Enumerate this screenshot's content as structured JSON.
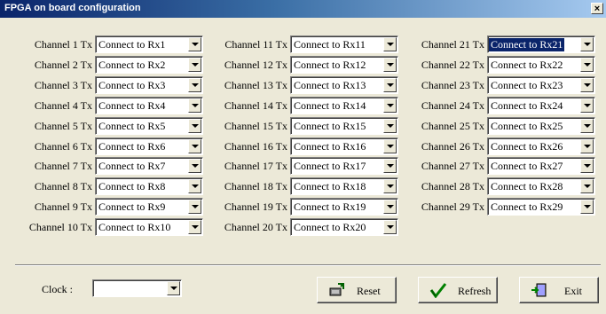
{
  "window": {
    "title": "FPGA on board configuration",
    "close": "×"
  },
  "channels": [
    {
      "label": "Channel 1 Tx",
      "value": "Connect to Rx1"
    },
    {
      "label": "Channel 2 Tx",
      "value": "Connect to Rx2"
    },
    {
      "label": "Channel 3 Tx",
      "value": "Connect to Rx3"
    },
    {
      "label": "Channel 4 Tx",
      "value": "Connect to Rx4"
    },
    {
      "label": "Channel 5 Tx",
      "value": "Connect to Rx5"
    },
    {
      "label": "Channel 6 Tx",
      "value": "Connect to Rx6"
    },
    {
      "label": "Channel 7 Tx",
      "value": "Connect to Rx7"
    },
    {
      "label": "Channel 8 Tx",
      "value": "Connect to Rx8"
    },
    {
      "label": "Channel 9 Tx",
      "value": "Connect to Rx9"
    },
    {
      "label": "Channel 10 Tx",
      "value": "Connect to Rx10"
    },
    {
      "label": "Channel 11 Tx",
      "value": "Connect to Rx11"
    },
    {
      "label": "Channel 12 Tx",
      "value": "Connect to Rx12"
    },
    {
      "label": "Channel 13 Tx",
      "value": "Connect to Rx13"
    },
    {
      "label": "Channel 14 Tx",
      "value": "Connect to Rx14"
    },
    {
      "label": "Channel 15 Tx",
      "value": "Connect to Rx15"
    },
    {
      "label": "Channel 16 Tx",
      "value": "Connect to Rx16"
    },
    {
      "label": "Channel 17 Tx",
      "value": "Connect to Rx17"
    },
    {
      "label": "Channel 18 Tx",
      "value": "Connect to Rx18"
    },
    {
      "label": "Channel 19 Tx",
      "value": "Connect to Rx19"
    },
    {
      "label": "Channel 20 Tx",
      "value": "Connect to Rx20"
    },
    {
      "label": "Channel 21 Tx",
      "value": "Connect to Rx21",
      "selected": true
    },
    {
      "label": "Channel 22 Tx",
      "value": "Connect to Rx22"
    },
    {
      "label": "Channel 23 Tx",
      "value": "Connect to Rx23"
    },
    {
      "label": "Channel 24 Tx",
      "value": "Connect to Rx24"
    },
    {
      "label": "Channel 25 Tx",
      "value": "Connect to Rx25"
    },
    {
      "label": "Channel 26 Tx",
      "value": "Connect to Rx26"
    },
    {
      "label": "Channel 27 Tx",
      "value": "Connect to Rx27"
    },
    {
      "label": "Channel 28 Tx",
      "value": "Connect to Rx28"
    },
    {
      "label": "Channel 29 Tx",
      "value": "Connect to Rx29"
    }
  ],
  "clock": {
    "label": "Clock :",
    "value": ""
  },
  "buttons": {
    "reset": {
      "label": "Reset",
      "icon": "reset-icon"
    },
    "refresh": {
      "label": "Refresh",
      "icon": "check-icon"
    },
    "exit": {
      "label": "Exit",
      "icon": "exit-icon"
    }
  },
  "colors": {
    "titlebar_start": "#0a246a",
    "titlebar_end": "#a6caf0",
    "face": "#ece9d8",
    "selection": "#0a246a"
  }
}
